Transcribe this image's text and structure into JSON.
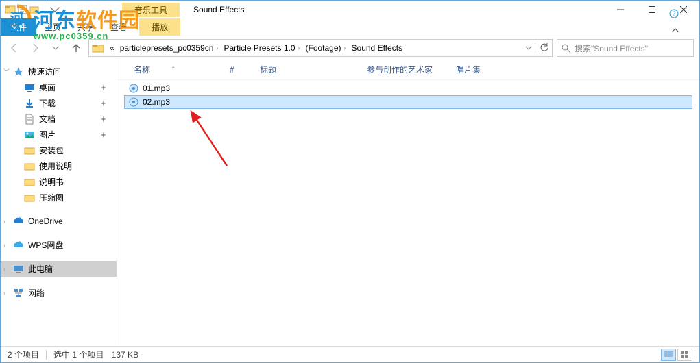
{
  "window": {
    "context_tab": "音乐工具",
    "title": "Sound Effects"
  },
  "ribbon": {
    "file": "文件",
    "home": "主页",
    "share": "共享",
    "view": "查看",
    "play": "播放"
  },
  "breadcrumb": {
    "ellipsis": "«",
    "items": [
      "particlepresets_pc0359cn",
      "Particle Presets 1.0",
      "(Footage)",
      "Sound Effects"
    ]
  },
  "search": {
    "placeholder": "搜索\"Sound Effects\""
  },
  "sidebar": {
    "quick": "快速访问",
    "desktop": "桌面",
    "downloads": "下载",
    "documents": "文档",
    "pictures": "图片",
    "pkg": "安装包",
    "instructions": "使用说明",
    "manual": "说明书",
    "thumbs": "压缩图",
    "onedrive": "OneDrive",
    "wps": "WPS网盘",
    "thispc": "此电脑",
    "network": "网络"
  },
  "columns": {
    "name": "名称",
    "num": "#",
    "title": "标题",
    "artist": "参与创作的艺术家",
    "album": "唱片集"
  },
  "files": [
    {
      "name": "01.mp3",
      "selected": false
    },
    {
      "name": "02.mp3",
      "selected": true
    }
  ],
  "status": {
    "count": "2 个项目",
    "selected": "选中 1 个项目",
    "size": "137 KB"
  },
  "watermark": {
    "text1": "河东软件园",
    "url": "www.pc0359.cn"
  }
}
